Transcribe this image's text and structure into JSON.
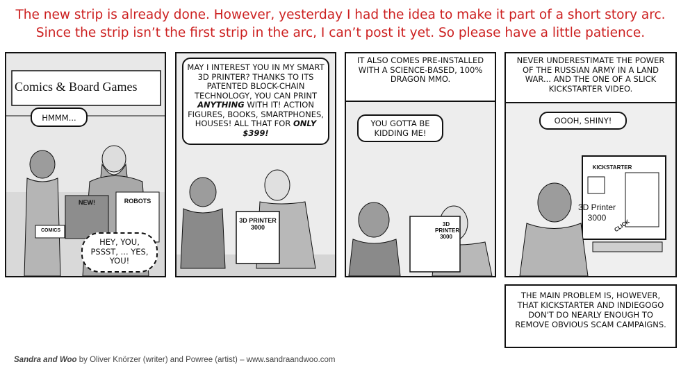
{
  "notice": {
    "line1": "The new strip is already done. However, yesterday I had the idea to make it part of a short story arc.",
    "line2": "Since the strip isn’t the first strip in the arc, I can’t post it yet. So please have a little patience."
  },
  "panel1": {
    "sign": "Comics & Board Games",
    "bubble_hmm": "HMMM...",
    "box_new": "NEW!",
    "box_robots": "ROBOTS",
    "box_comics": "COMICS",
    "bubble_whisper": "HEY, YOU, PSSST, ... YES, YOU!"
  },
  "panel2": {
    "bubble_a": "MAY I INTEREST YOU IN MY SMART 3D PRINTER? THANKS TO ITS PATENTED BLOCK-CHAIN TECHNOLOGY, YOU CAN PRINT",
    "bubble_anything": "ANYTHING",
    "bubble_b": "WITH IT! ACTION FIGURES, BOOKS, SMARTPHONES, HOUSES! ALL THAT FOR",
    "bubble_price": "ONLY $399!",
    "box_label": "3D PRINTER 3000"
  },
  "panel3": {
    "caption": "IT ALSO COMES PRE-INSTALLED WITH A SCIENCE-BASED, 100% DRAGON MMO.",
    "bubble": "YOU GOTTA BE KIDDING ME!",
    "box_label": "3D PRINTER 3000"
  },
  "panel4": {
    "caption": "NEVER UNDERESTIMATE THE POWER OF THE RUSSIAN ARMY IN A LAND WAR... AND THE ONE OF A SLICK KICKSTARTER VIDEO.",
    "bubble": "OOOH, SHINY!",
    "screen_brand": "KICKSTARTER",
    "screen_product": "3D Printer 3000",
    "sfx": "CLICK"
  },
  "bottom_caption": "THE MAIN PROBLEM IS, HOWEVER, THAT KICKSTARTER AND INDIEGOGO DON'T DO NEARLY ENOUGH TO REMOVE OBVIOUS SCAM CAMPAIGNS.",
  "credit": {
    "title": "Sandra and Woo",
    "rest": " by Oliver Knörzer (writer) and Powree (artist) – www.sandraandwoo.com"
  }
}
